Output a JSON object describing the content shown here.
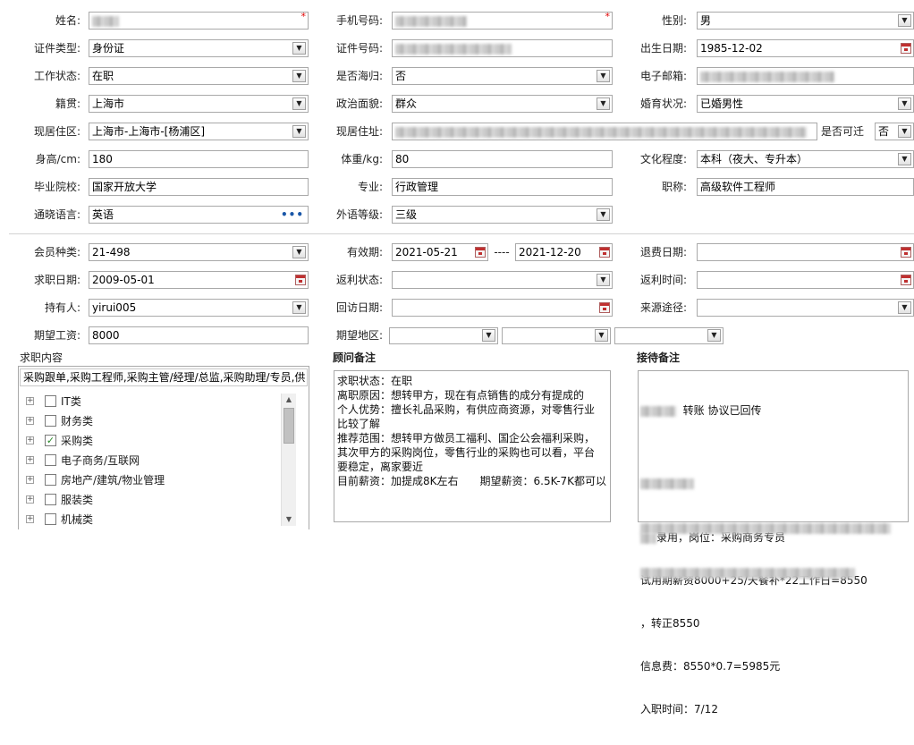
{
  "personal": {
    "name_label": "姓名:",
    "phone_label": "手机号码:",
    "gender_label": "性别:",
    "gender_value": "男",
    "id_type_label": "证件类型:",
    "id_type_value": "身份证",
    "id_number_label": "证件号码:",
    "birth_label": "出生日期:",
    "birth_value": "1985-12-02",
    "work_status_label": "工作状态:",
    "work_status_value": "在职",
    "returnee_label": "是否海归:",
    "returnee_value": "否",
    "email_label": "电子邮箱:",
    "native_label": "籍贯:",
    "native_value": "上海市",
    "political_label": "政治面貌:",
    "political_value": "群众",
    "marital_label": "婚育状况:",
    "marital_value": "已婚男性",
    "residence_area_label": "现居住区:",
    "residence_area_value": "上海市-上海市-[杨浦区]",
    "residence_addr_label": "现居住址:",
    "relocate_label": "是否可迁",
    "relocate_value": "否",
    "height_label": "身高/cm:",
    "height_value": "180",
    "weight_label": "体重/kg:",
    "weight_value": "80",
    "education_label": "文化程度:",
    "education_value": "本科（夜大、专升本）",
    "school_label": "毕业院校:",
    "school_value": "国家开放大学",
    "major_label": "专业:",
    "major_value": "行政管理",
    "title_label": "职称:",
    "title_value": "高级软件工程师",
    "language_label": "通晓语言:",
    "language_value": "英语",
    "language_dots": "•••",
    "lang_level_label": "外语等级:",
    "lang_level_value": "三级",
    "required_mark": "*"
  },
  "membership": {
    "member_type_label": "会员种类:",
    "member_type_value": "21-498",
    "valid_label": "有效期:",
    "valid_from": "2021-05-21",
    "valid_sep": "----",
    "valid_to": "2021-12-20",
    "refund_date_label": "退费日期:",
    "job_date_label": "求职日期:",
    "job_date_value": "2009-05-01",
    "rebate_status_label": "返利状态:",
    "rebate_time_label": "返利时间:",
    "holder_label": "持有人:",
    "holder_value": "yirui005",
    "revisit_label": "回访日期:",
    "source_label": "来源途径:",
    "salary_label": "期望工资:",
    "salary_value": "8000",
    "region_label": "期望地区:"
  },
  "job_content": {
    "title": "求职内容",
    "summary": "采购跟单,采购工程师,采购主管/经理/总监,采购助理/专员,供",
    "items": [
      {
        "label": "IT类",
        "checked": false
      },
      {
        "label": "财务类",
        "checked": false
      },
      {
        "label": "采购类",
        "checked": true
      },
      {
        "label": "电子商务/互联网",
        "checked": false
      },
      {
        "label": "房地产/建筑/物业管理",
        "checked": false
      },
      {
        "label": "服装类",
        "checked": false
      },
      {
        "label": "机械类",
        "checked": false
      }
    ],
    "expand_glyph": "+",
    "check_glyph": "✓"
  },
  "consultant_notes": {
    "title": "顾问备注",
    "text": "求职状态：在职\n离职原因：想转甲方，现在有点销售的成分有提成的\n个人优势：擅长礼品采购，有供应商资源，对零售行业\n比较了解\n推荐范围：想转甲方做员工福利、国企公会福利采购，\n其次甲方的采购岗位，零售行业的采购也可以看，平台\n要稳定，离家要近\n目前薪资：加提成8K左右　　期望薪资：6.5K-7K都可以"
  },
  "reception_notes": {
    "title": "接待备注",
    "line1": "转账 协议已回传",
    "line2": "录用，岗位：采购商务专员",
    "line3": "试用期薪资8000+25/天餐补*22工作日=8550",
    "line4": "，转正8550",
    "line5": "信息费：8550*0.7=5985元",
    "line6": "入职时间：7/12"
  },
  "icons": {
    "dropdown": "▼",
    "scroll_up": "▲",
    "scroll_down": "▼"
  }
}
